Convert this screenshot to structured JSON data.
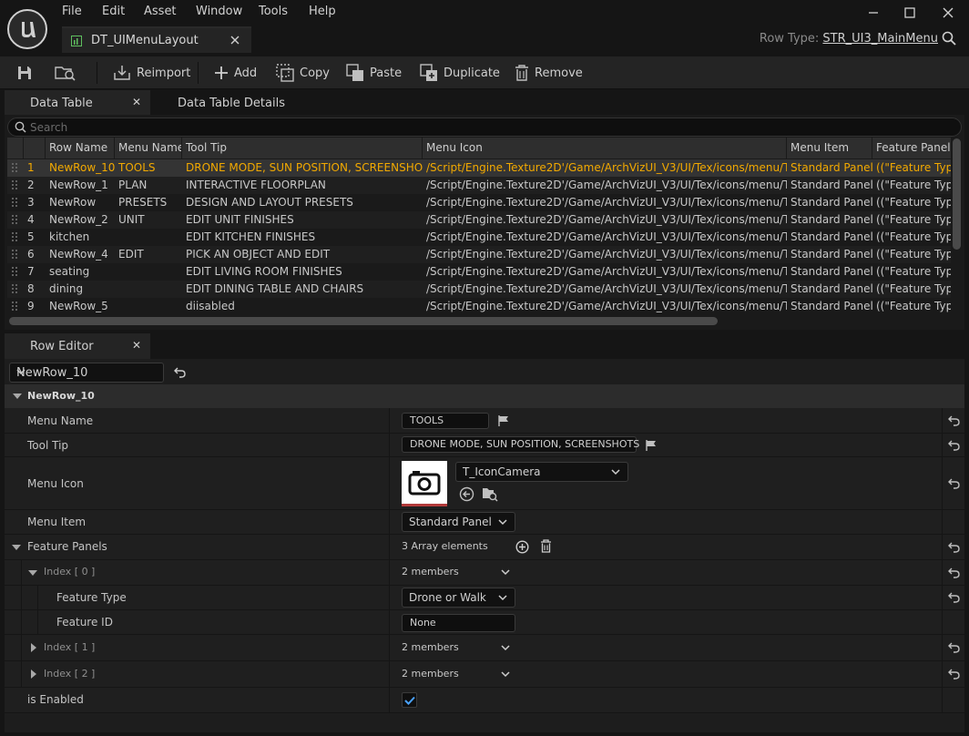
{
  "menubar": {
    "items": [
      "File",
      "Edit",
      "Asset",
      "Window",
      "Tools",
      "Help"
    ]
  },
  "asset_tab": {
    "label": "DT_UIMenuLayout"
  },
  "row_type": {
    "label": "Row Type:",
    "value": "STR_UI3_MainMenu"
  },
  "toolbar": {
    "reimport": "Reimport",
    "add": "Add",
    "copy": "Copy",
    "paste": "Paste",
    "duplicate": "Duplicate",
    "remove": "Remove"
  },
  "panel_tabs": {
    "data_table": "Data Table",
    "data_table_details": "Data Table Details"
  },
  "search": {
    "placeholder": "Search"
  },
  "table": {
    "columns": [
      "Row Name",
      "Menu Name",
      "Tool Tip",
      "Menu Icon",
      "Menu Item",
      "Feature Panel"
    ],
    "rows": [
      {
        "num": "1",
        "row_name": "NewRow_10",
        "menu_name": "TOOLS",
        "tool_tip": "DRONE MODE, SUN POSITION, SCREENSHOTS",
        "menu_icon": "/Script/Engine.Texture2D'/Game/ArchVizUI_V3/UI/Tex/icons/menu/T_IconCamera.T_IconCamera'",
        "menu_item": "Standard Panel",
        "feature_panel": "((\"Feature Type\"",
        "selected": true
      },
      {
        "num": "2",
        "row_name": "NewRow_1",
        "menu_name": "PLAN",
        "tool_tip": "INTERACTIVE FLOORPLAN",
        "menu_icon": "/Script/Engine.Texture2D'/Game/ArchVizUI_V3/UI/Tex/icons/menu/T_IconPlan.T_IconPlan'",
        "menu_item": "Standard Panel",
        "feature_panel": "((\"Feature Type\""
      },
      {
        "num": "3",
        "row_name": "NewRow",
        "menu_name": "PRESETS",
        "tool_tip": "DESIGN AND LAYOUT PRESETS",
        "menu_icon": "/Script/Engine.Texture2D'/Game/ArchVizUI_V3/UI/Tex/icons/menu/T_IconPresets.T_IconPresets'",
        "menu_item": "Standard Panel",
        "feature_panel": "((\"Feature Type\""
      },
      {
        "num": "4",
        "row_name": "NewRow_2",
        "menu_name": "UNIT",
        "tool_tip": "EDIT UNIT FINISHES",
        "menu_icon": "/Script/Engine.Texture2D'/Game/ArchVizUI_V3/UI/Tex/icons/menu/T_IconUnit.T_IconUnit'",
        "menu_item": "Standard Panel",
        "feature_panel": "((\"Feature Type\""
      },
      {
        "num": "5",
        "row_name": "kitchen",
        "menu_name": "",
        "tool_tip": "EDIT KITCHEN FINISHES",
        "menu_icon": "/Script/Engine.Texture2D'/Game/ArchVizUI_V3/UI/Tex/icons/menu/T_IconKitchen.T_IconKitchen'",
        "menu_item": "Standard Panel",
        "feature_panel": "((\"Feature Type\""
      },
      {
        "num": "6",
        "row_name": "NewRow_4",
        "menu_name": "EDIT",
        "tool_tip": "PICK AN OBJECT AND EDIT",
        "menu_icon": "/Script/Engine.Texture2D'/Game/ArchVizUI_V3/UI/Tex/icons/menu/T_IconEdit.T_IconEdit'",
        "menu_item": "Standard Panel",
        "feature_panel": "((\"Feature Type\""
      },
      {
        "num": "7",
        "row_name": "seating",
        "menu_name": "",
        "tool_tip": "EDIT LIVING ROOM FINISHES",
        "menu_icon": "/Script/Engine.Texture2D'/Game/ArchVizUI_V3/UI/Tex/icons/menu/T_IconSeating.T_IconSeating'",
        "menu_item": "Standard Panel",
        "feature_panel": "((\"Feature Type\""
      },
      {
        "num": "8",
        "row_name": "dining",
        "menu_name": "",
        "tool_tip": "EDIT DINING TABLE AND CHAIRS",
        "menu_icon": "/Script/Engine.Texture2D'/Game/ArchVizUI_V3/UI/Tex/icons/menu/T_IconDining.T_IconDining'",
        "menu_item": "Standard Panel",
        "feature_panel": "((\"Feature Type\""
      },
      {
        "num": "9",
        "row_name": "NewRow_5",
        "menu_name": "",
        "tool_tip": "diisabled",
        "menu_icon": "/Script/Engine.Texture2D'/Game/ArchVizUI_V3/UI/Tex/icons/menu/T_IconDisabled.T_IconDisabled'",
        "menu_item": "Standard Panel",
        "feature_panel": "((\"Feature Type\""
      }
    ]
  },
  "row_editor": {
    "tab_label": "Row Editor",
    "selected_row": "NewRow_10",
    "section_title": "NewRow_10",
    "menu_name": {
      "label": "Menu Name",
      "value": "TOOLS"
    },
    "tool_tip": {
      "label": "Tool Tip",
      "value": "DRONE MODE, SUN POSITION, SCREENSHOTS"
    },
    "menu_icon": {
      "label": "Menu Icon",
      "value": "T_IconCamera"
    },
    "menu_item": {
      "label": "Menu Item",
      "value": "Standard Panel"
    },
    "feature_panels": {
      "label": "Feature Panels",
      "count_text": "3 Array elements",
      "index0": {
        "label": "Index [ 0 ]",
        "members": "2 members"
      },
      "feature_type": {
        "label": "Feature Type",
        "value": "Drone or Walk"
      },
      "feature_id": {
        "label": "Feature ID",
        "value": "None"
      },
      "index1": {
        "label": "Index [ 1 ]",
        "members": "2 members"
      },
      "index2": {
        "label": "Index [ 2 ]",
        "members": "2 members"
      }
    },
    "is_enabled": {
      "label": "is Enabled",
      "checked": true
    }
  },
  "colors": {
    "selected_text": "#f2a900",
    "checkbox_check": "#4aa3ff"
  }
}
